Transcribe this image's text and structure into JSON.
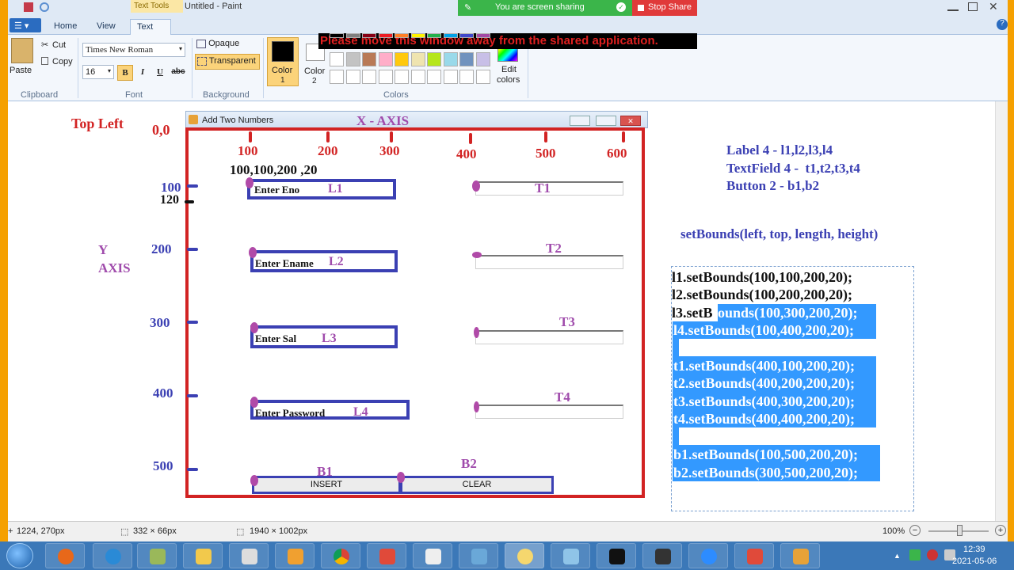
{
  "window": {
    "title": "Untitled - Paint",
    "tools_label": "Text Tools"
  },
  "screen_share": {
    "message": "You are screen sharing",
    "stop_label": "Stop Share",
    "warning": "Please move this window away from the shared application."
  },
  "ribbon": {
    "tabs": [
      "Home",
      "View",
      "Text"
    ],
    "clipboard": {
      "paste": "Paste",
      "cut": "Cut",
      "copy": "Copy",
      "group": "Clipboard"
    },
    "font": {
      "family": "Times New Roman",
      "size": "16",
      "bold": "B",
      "italic": "I",
      "underline": "U",
      "strike": "abc",
      "group": "Font"
    },
    "background": {
      "opaque": "Opaque",
      "transparent": "Transparent",
      "group": "Background"
    },
    "colors": {
      "color1": "Color\n1",
      "color1_a": "Color",
      "color1_b": "1",
      "color2_a": "Color",
      "color2_b": "2",
      "edit_a": "Edit",
      "edit_b": "colors",
      "group": "Colors"
    }
  },
  "drawing": {
    "top_left": "Top Left",
    "origin": "0,0",
    "x_axis": "X - AXIS",
    "x_ticks": [
      "100",
      "200",
      "300",
      "400",
      "500",
      "600"
    ],
    "y_label_1": "Y",
    "y_label_2": "AXIS",
    "y_ticks": [
      "100",
      "200",
      "300",
      "400",
      "500"
    ],
    "y_120": "120",
    "coords_note": "100,100,200 ,20",
    "app_window_title": "Add Two Numbers",
    "labels": [
      {
        "text": "Enter Eno",
        "tag": "L1"
      },
      {
        "text": "Enter Ename",
        "tag": "L2"
      },
      {
        "text": "Enter Sal",
        "tag": "L3"
      },
      {
        "text": "Enter Password",
        "tag": "L4"
      }
    ],
    "textfield_tags": [
      "T1",
      "T2",
      "T3",
      "T4"
    ],
    "buttons": [
      {
        "text": "INSERT",
        "tag": "B1"
      },
      {
        "text": "CLEAR",
        "tag": "B2"
      }
    ],
    "summary": {
      "label_line": "Label 4 - l1,l2,l3,l4",
      "textfield_line": "TextField 4 -  t1,t2,t3,t4",
      "button_line": "Button 2 - b1,b2"
    },
    "setbounds_title": "setBounds(left, top, length, height)",
    "code": {
      "l1": "l1.setBounds(100,100,200,20);",
      "l2": "l2.setBounds(100,200,200,20);",
      "l3_plain": "l3.setB",
      "l3_hl": "ounds(100,300,200,20);",
      "l4": "l4.setBounds(100,400,200,20);",
      "t1": "t1.setBounds(400,100,200,20);",
      "t2": "t2.setBounds(400,200,200,20);",
      "t3": "t3.setBounds(400,300,200,20);",
      "t4": "t4.setBounds(400,400,200,20);",
      "b1": "b1.setBounds(100,500,200,20);",
      "b2": "b2.setBounds(300,500,200,20);"
    }
  },
  "status": {
    "cursor": "1224, 270px",
    "selection": "332 × 66px",
    "image_size": "1940 × 1002px",
    "zoom": "100%"
  },
  "taskbar": {
    "time": "12:39",
    "date": "2021-05-06"
  },
  "colors": {
    "axis_red": "#d22323",
    "box_blue": "#3b40b3",
    "tag_purple": "#a04cac",
    "highlight": "#3399ff"
  }
}
